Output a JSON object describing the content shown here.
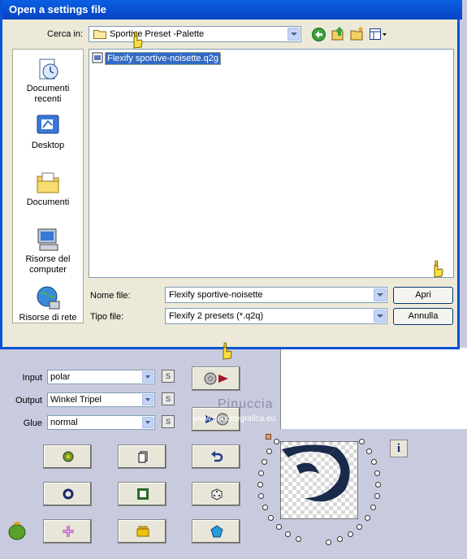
{
  "dialog": {
    "title": "Open a settings file",
    "look_in_label": "Cerca in:",
    "look_in_value": "Sportive Preset -Palette",
    "places": [
      {
        "label": "Documenti recenti",
        "icon": "recent-documents-icon"
      },
      {
        "label": "Desktop",
        "icon": "desktop-icon"
      },
      {
        "label": "Documenti",
        "icon": "documents-folder-icon"
      },
      {
        "label": "Risorse del computer",
        "icon": "my-computer-icon"
      },
      {
        "label": "Risorse di rete",
        "icon": "network-icon"
      }
    ],
    "files": [
      {
        "name": "Flexify sportive-noisette.q2g",
        "selected": true
      }
    ],
    "filename_label": "Nome file:",
    "filename_value": "Flexify sportive-noisette",
    "filetype_label": "Tipo file:",
    "filetype_value": "Flexify 2 presets (*.q2q)",
    "open_button": "Apri",
    "cancel_button": "Annulla",
    "colors": {
      "title_bar": "#0a53d6",
      "selection": "#316ac5"
    }
  },
  "plugin": {
    "input_label": "Input",
    "input_value": "polar",
    "output_label": "Output",
    "output_value": "Winkel Tripel",
    "glue_label": "Glue",
    "glue_value": "normal",
    "s_button": "S",
    "info_button": "i",
    "watermark": "Pinuccia",
    "watermark_url": "www.doudiregrafica.eu"
  }
}
